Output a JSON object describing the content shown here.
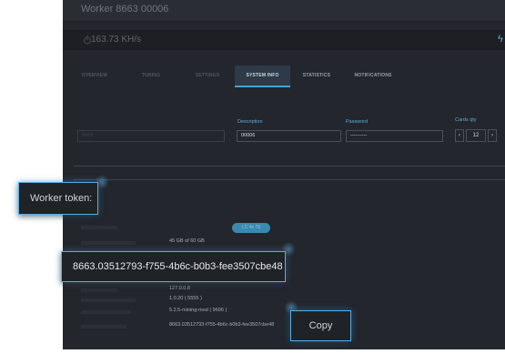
{
  "worker": {
    "title": "Worker 8663 00006"
  },
  "hashrate": {
    "value": "163.73 KH/s"
  },
  "tabs": [
    {
      "label": "OVERVIEW"
    },
    {
      "label": "TUNING"
    },
    {
      "label": "SETTINGS"
    },
    {
      "label": "SYSTEM INFO"
    },
    {
      "label": "STATISTICS"
    },
    {
      "label": "NOTIFICATIONS"
    }
  ],
  "form": {
    "name_value": "8663",
    "description_label": "Description",
    "description_value": "00006",
    "password_label": "Password",
    "password_value": "----------",
    "cards_label": "Cards qty",
    "cards_value": "12",
    "minus": "‹",
    "plus": "›"
  },
  "info": {
    "pill": "LC 4x 78",
    "disk": "45 GB of 60 GB",
    "ip": "127.0.0.8",
    "client_version": "1.0.20 ( 5555 )",
    "miner_version": "5.2.5-mining-mod ( 9696 )",
    "token_small": "8663.03512793-f755-4b6c-b0b3-fee3507cbe48"
  },
  "callouts": {
    "worker_token_label": "Worker token:",
    "worker_token_value": "8663.03512793-f755-4b6c-b0b3-fee3507cbe48",
    "copy_label": "Copy"
  },
  "colors": {
    "accent": "#5aaee2",
    "background": "#23262c"
  }
}
